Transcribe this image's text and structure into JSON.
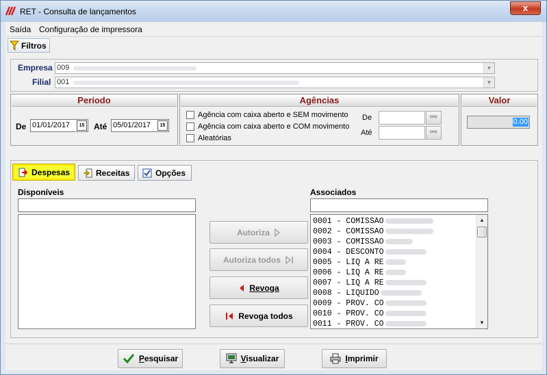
{
  "window": {
    "title": "RET - Consulta de lançamentos",
    "close_label": "x"
  },
  "menu": {
    "items": [
      "Saída",
      "Configuração de impressora"
    ]
  },
  "toolbar": {
    "filtros_label": "Filtros"
  },
  "empresa": {
    "label": "Empresa",
    "value": "009"
  },
  "filial": {
    "label": "Filial",
    "value": "001"
  },
  "periodo": {
    "title": "Período",
    "de_label": "De",
    "de_value": "01/01/2017",
    "ate_label": "Até",
    "ate_value": "05/01/2017",
    "cal_glyph": "15"
  },
  "agencias": {
    "title": "Agências",
    "options": [
      "Agência com caixa aberto e SEM movimento",
      "Agência com caixa aberto e COM movimento",
      "Aleatórias"
    ],
    "de_label": "De",
    "ate_label": "Até"
  },
  "valor": {
    "title": "Valor",
    "value": "0.00"
  },
  "tabs": {
    "despesas": "Despesas",
    "receitas": "Receitas",
    "opcoes": "Opções"
  },
  "disponiveis": {
    "label": "Disponíveis"
  },
  "associados": {
    "label": "Associados",
    "items": [
      "0001 - COMISSAO",
      "0002 - COMISSAO",
      "0003 - COMISSAO",
      "0004 - DESCONTO",
      "0005 - LIQ A RE",
      "0006 - LIQ A RE",
      "0007 - LIQ A RE",
      "0008 - LIQUIDO",
      "0009 - PROV. CO",
      "0010 - PROV. CO",
      "0011 - PROV. CO"
    ]
  },
  "actions": {
    "autoriza": "Autoriza",
    "autoriza_todos": "Autoriza todos",
    "revoga": "Revoga",
    "revoga_todos": "Revoga todos"
  },
  "bottom": {
    "pesquisar": "Pesquisar",
    "visualizar": "Visualizar",
    "imprimir": "Imprimir"
  },
  "colors": {
    "group_title": "#8b1a1a",
    "label_blue": "#1c2f6e",
    "active_tab": "#f7ff30",
    "selection": "#3399ff"
  }
}
